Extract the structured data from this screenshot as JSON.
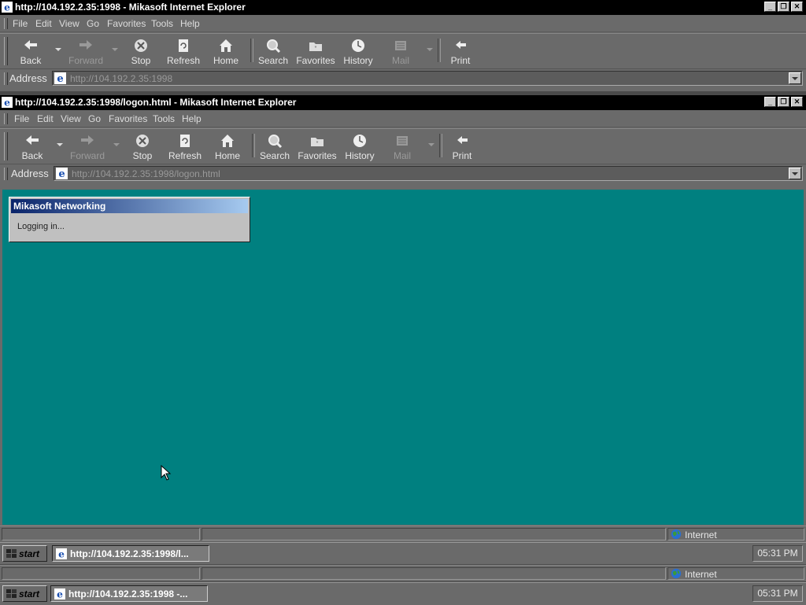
{
  "back_window": {
    "title": "http://104.192.2.35:1998 - Mikasoft Internet Explorer",
    "address_url": "http://104.192.2.35:1998"
  },
  "front_window": {
    "title": "http://104.192.2.35:1998/logon.html - Mikasoft Internet Explorer",
    "address_url": "http://104.192.2.35:1998/logon.html"
  },
  "menu": [
    "File",
    "Edit",
    "View",
    "Go",
    "Favorites",
    "Tools",
    "Help"
  ],
  "toolbar": {
    "back": "Back",
    "forward": "Forward",
    "stop": "Stop",
    "refresh": "Refresh",
    "home": "Home",
    "search": "Search",
    "favorites": "Favorites",
    "history": "History",
    "mail": "Mail",
    "print": "Print"
  },
  "address_label": "Address",
  "dialog": {
    "title": "Mikasoft Networking",
    "message": "Logging in..."
  },
  "status": {
    "zone": "Internet"
  },
  "taskbar_front": {
    "start": "start",
    "task": "http://104.192.2.35:1998/l...",
    "clock": "05:31 PM"
  },
  "taskbar_back": {
    "start": "start",
    "task": "http://104.192.2.35:1998 -...",
    "clock": "05:31 PM"
  },
  "colors": {
    "desktop": "#008080",
    "titlebar": "#000000",
    "dialog_title": "#0a246a"
  }
}
